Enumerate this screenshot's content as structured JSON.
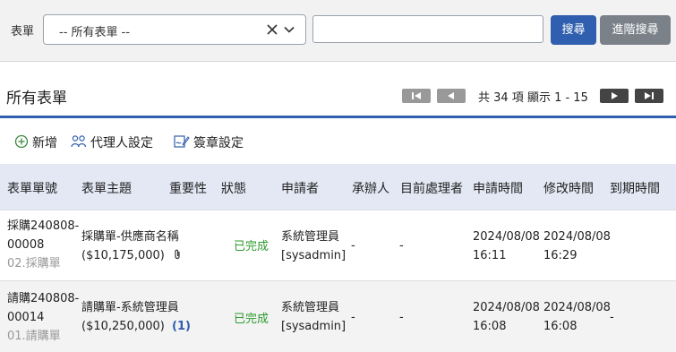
{
  "search": {
    "form_label": "表單",
    "form_select_value": "-- 所有表單 --",
    "keyword_value": "",
    "search_button": "搜尋",
    "advanced_button": "進階搜尋"
  },
  "header": {
    "title": "所有表單",
    "pagination_info": "共 34 項 顯示 1 - 15"
  },
  "toolbar": {
    "add_label": "新增",
    "delegate_label": "代理人設定",
    "signature_label": "簽章設定"
  },
  "table": {
    "columns": [
      "表單單號",
      "表單主題",
      "重要性",
      "狀態",
      "申請者",
      "承辦人",
      "目前處理者",
      "申請時間",
      "修改時間",
      "到期時間"
    ],
    "rows": [
      {
        "no_line1": "採購240808-",
        "no_line2": "00008",
        "category": "02.採購單",
        "subject_line1": "採購單-供應商名稱",
        "subject_line2": "($10,175,000)",
        "attachment": true,
        "status": "已完成",
        "applicant_line1": "系統管理員",
        "applicant_line2": "[sysadmin]",
        "handler": "-",
        "current": "-",
        "apply_date": "2024/08/08",
        "apply_time": "16:11",
        "mod_date": "2024/08/08",
        "mod_time": "16:29",
        "due": ""
      },
      {
        "no_line1": "請購240808-",
        "no_line2": "00014",
        "category": "01.請購單",
        "subject_line1": "請購單-系統管理員",
        "subject_line2": "($10,250,000)",
        "count": "(1)",
        "status": "已完成",
        "applicant_line1": "系統管理員",
        "applicant_line2": "[sysadmin]",
        "handler": "-",
        "current": "-",
        "apply_date": "2024/08/08",
        "apply_time": "16:08",
        "mod_date": "2024/08/08",
        "mod_time": "16:08",
        "due": "-"
      }
    ]
  },
  "colors": {
    "primary": "#2f5fae",
    "secondary": "#7a8189",
    "success": "#2e9b2e",
    "header_bg": "#e3e8f4"
  }
}
